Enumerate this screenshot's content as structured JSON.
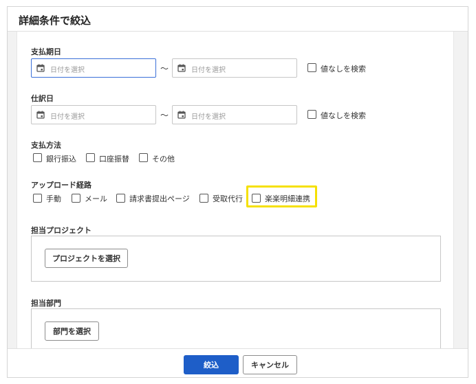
{
  "dialog": {
    "title": "詳細条件で絞込"
  },
  "payment_date": {
    "label": "支払期日",
    "from_placeholder": "日付を選択",
    "separator": "〜",
    "to_placeholder": "日付を選択",
    "no_value_label": "値なしを検索"
  },
  "journal_date": {
    "label": "仕訳日",
    "from_placeholder": "日付を選択",
    "separator": "〜",
    "to_placeholder": "日付を選択",
    "no_value_label": "値なしを検索"
  },
  "payment_method": {
    "label": "支払方法",
    "options": [
      "銀行振込",
      "口座振替",
      "その他"
    ]
  },
  "upload_route": {
    "label": "アップロード経路",
    "options": [
      "手動",
      "メール",
      "請求書提出ページ",
      "受取代行",
      "楽楽明細連携"
    ]
  },
  "project": {
    "label": "担当プロジェクト",
    "button_label": "プロジェクトを選択"
  },
  "department": {
    "label": "担当部門",
    "button_label": "部門を選択"
  },
  "footer": {
    "apply_label": "絞込",
    "cancel_label": "キャンセル"
  },
  "colors": {
    "primary": "#1e5ec8",
    "focus_border": "#3a6fd8",
    "highlight": "#f5e000"
  },
  "icons": {
    "date_input": "calendar-icon"
  }
}
